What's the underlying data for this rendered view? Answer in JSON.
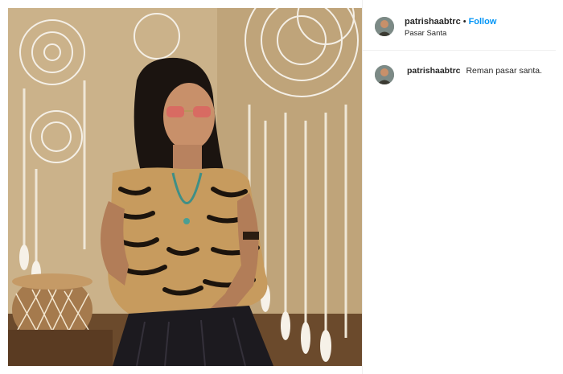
{
  "post": {
    "username": "patrishaabtrc",
    "separator": "•",
    "follow_label": "Follow",
    "location": "Pasar Santa"
  },
  "comments": [
    {
      "username": "patrishaabtrc",
      "text": "Reman pasar santa."
    }
  ],
  "colors": {
    "follow": "#0095f6",
    "text": "#262626",
    "divider": "#efefef"
  }
}
